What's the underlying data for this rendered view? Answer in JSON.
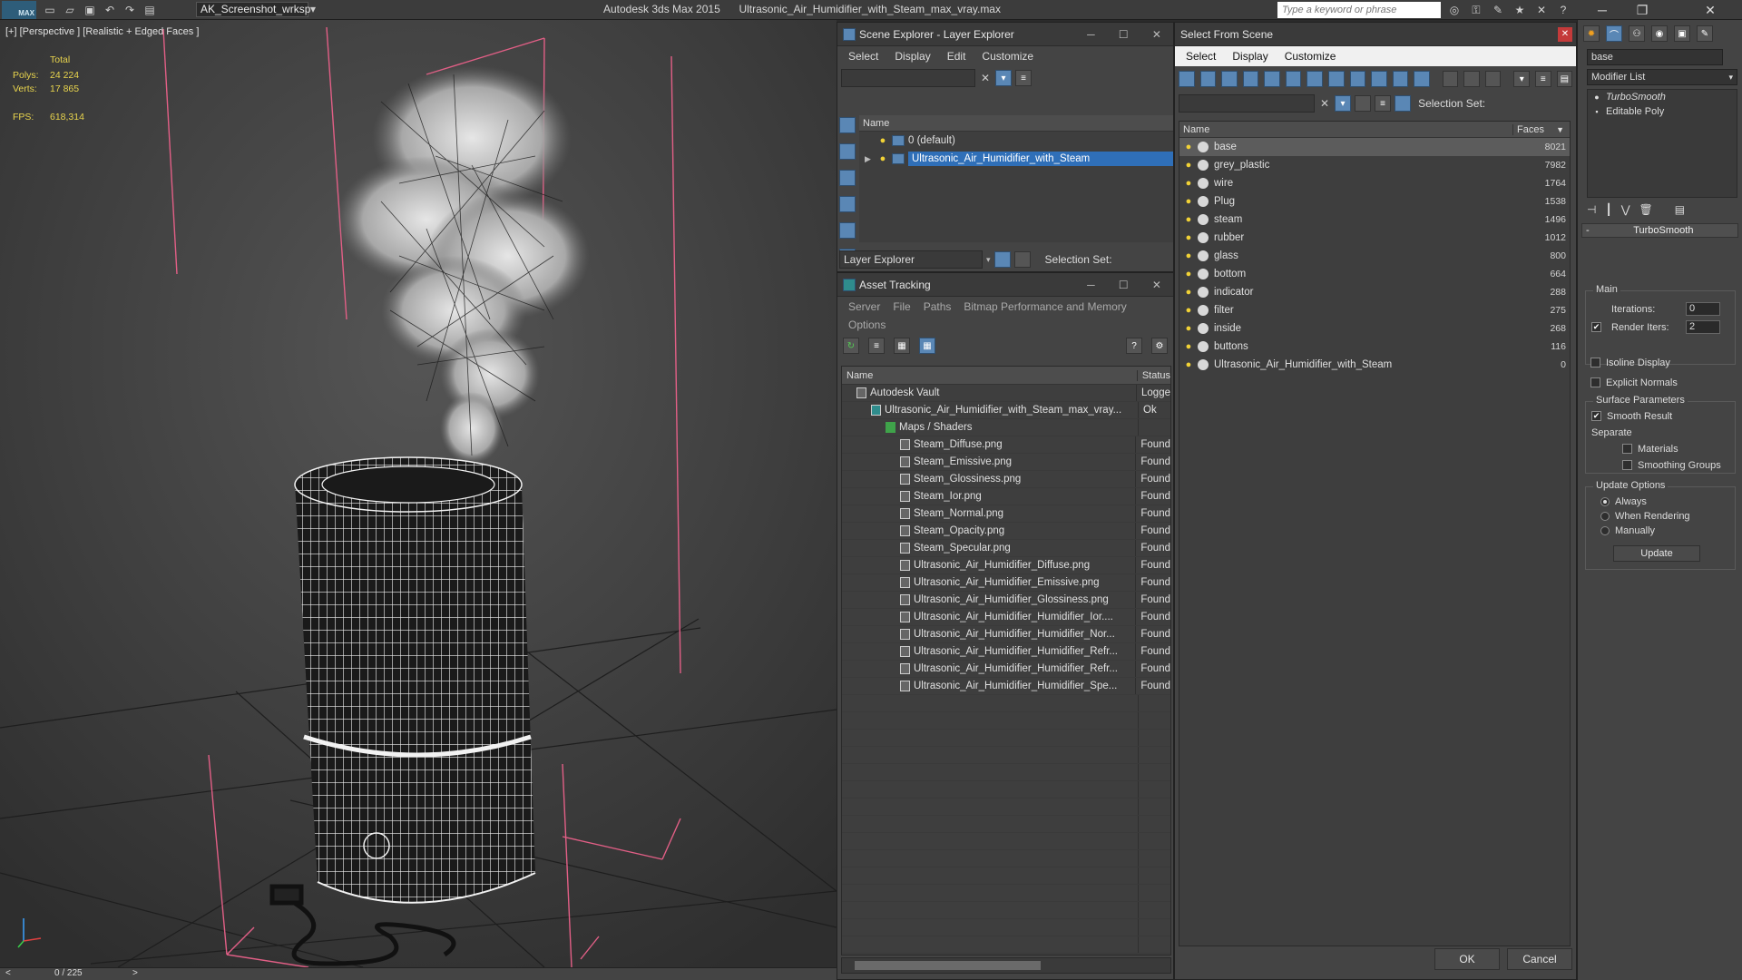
{
  "titlebar": {
    "logo": "MAX",
    "workspace": "AK_Screenshot_wrksp",
    "app_name": "Autodesk 3ds Max  2015",
    "file_name": "Ultrasonic_Air_Humidifier_with_Steam_max_vray.max",
    "search_placeholder": "Type a keyword or phrase"
  },
  "viewport": {
    "label": "[+] [Perspective ] [Realistic + Edged Faces ]",
    "stats": {
      "total_label": "Total",
      "polys_label": "Polys:",
      "polys_value": "24 224",
      "verts_label": "Verts:",
      "verts_value": "17 865",
      "fps_label": "FPS:",
      "fps_value": "618,314"
    },
    "timeline": "0 / 225",
    "timeline_prev": "<",
    "timeline_next": ">"
  },
  "scene_explorer": {
    "title": "Scene Explorer - Layer Explorer",
    "menu": [
      "Select",
      "Display",
      "Edit",
      "Customize"
    ],
    "column": "Name",
    "layers": [
      {
        "name": "0 (default)",
        "selected": false
      },
      {
        "name": "Ultrasonic_Air_Humidifier_with_Steam",
        "selected": true
      }
    ],
    "footer_dropdown": "Layer Explorer",
    "selection_set_label": "Selection Set:"
  },
  "asset_tracking": {
    "title": "Asset Tracking",
    "menu": [
      "Server",
      "File",
      "Paths",
      "Bitmap Performance and Memory"
    ],
    "menu2": "Options",
    "columns": [
      "Name",
      "Status"
    ],
    "rows": [
      {
        "name": "Autodesk Vault",
        "status": "Logge",
        "indent": 1
      },
      {
        "name": "Ultrasonic_Air_Humidifier_with_Steam_max_vray...",
        "status": "Ok",
        "indent": 2
      },
      {
        "name": "Maps / Shaders",
        "status": "",
        "indent": 3
      },
      {
        "name": "Steam_Diffuse.png",
        "status": "Found",
        "indent": 4
      },
      {
        "name": "Steam_Emissive.png",
        "status": "Found",
        "indent": 4
      },
      {
        "name": "Steam_Glossiness.png",
        "status": "Found",
        "indent": 4
      },
      {
        "name": "Steam_Ior.png",
        "status": "Found",
        "indent": 4
      },
      {
        "name": "Steam_Normal.png",
        "status": "Found",
        "indent": 4
      },
      {
        "name": "Steam_Opacity.png",
        "status": "Found",
        "indent": 4
      },
      {
        "name": "Steam_Specular.png",
        "status": "Found",
        "indent": 4
      },
      {
        "name": "Ultrasonic_Air_Humidifier_Diffuse.png",
        "status": "Found",
        "indent": 4
      },
      {
        "name": "Ultrasonic_Air_Humidifier_Emissive.png",
        "status": "Found",
        "indent": 4
      },
      {
        "name": "Ultrasonic_Air_Humidifier_Glossiness.png",
        "status": "Found",
        "indent": 4
      },
      {
        "name": "Ultrasonic_Air_Humidifier_Humidifier_Ior....",
        "status": "Found",
        "indent": 4
      },
      {
        "name": "Ultrasonic_Air_Humidifier_Humidifier_Nor...",
        "status": "Found",
        "indent": 4
      },
      {
        "name": "Ultrasonic_Air_Humidifier_Humidifier_Refr...",
        "status": "Found",
        "indent": 4
      },
      {
        "name": "Ultrasonic_Air_Humidifier_Humidifier_Refr...",
        "status": "Found",
        "indent": 4
      },
      {
        "name": "Ultrasonic_Air_Humidifier_Humidifier_Spe...",
        "status": "Found",
        "indent": 4
      }
    ]
  },
  "select_from_scene": {
    "title": "Select From Scene",
    "menu": [
      "Select",
      "Display",
      "Customize"
    ],
    "selection_set_label": "Selection Set:",
    "columns": [
      "Name",
      "Faces"
    ],
    "objects": [
      {
        "name": "base",
        "faces": "8021",
        "selected": true
      },
      {
        "name": "grey_plastic",
        "faces": "7982",
        "selected": false
      },
      {
        "name": "wire",
        "faces": "1764",
        "selected": false
      },
      {
        "name": "Plug",
        "faces": "1538",
        "selected": false
      },
      {
        "name": "steam",
        "faces": "1496",
        "selected": false
      },
      {
        "name": "rubber",
        "faces": "1012",
        "selected": false
      },
      {
        "name": "glass",
        "faces": "800",
        "selected": false
      },
      {
        "name": "bottom",
        "faces": "664",
        "selected": false
      },
      {
        "name": "indicator",
        "faces": "288",
        "selected": false
      },
      {
        "name": "filter",
        "faces": "275",
        "selected": false
      },
      {
        "name": "inside",
        "faces": "268",
        "selected": false
      },
      {
        "name": "buttons",
        "faces": "116",
        "selected": false
      },
      {
        "name": "Ultrasonic_Air_Humidifier_with_Steam",
        "faces": "0",
        "selected": false
      }
    ],
    "ok_label": "OK",
    "cancel_label": "Cancel"
  },
  "command_panel": {
    "object_name": "base",
    "modifier_list": "Modifier List",
    "stack": [
      "TurboSmooth",
      "Editable Poly"
    ],
    "rollout_title": "TurboSmooth",
    "main_group": "Main",
    "iterations_label": "Iterations:",
    "iterations_value": "0",
    "render_iters_label": "Render Iters:",
    "render_iters_value": "2",
    "render_iters_checked": true,
    "isoline_label": "Isoline Display",
    "explicit_normals_label": "Explicit Normals",
    "surface_group": "Surface Parameters",
    "smooth_result_label": "Smooth Result",
    "separate_label": "Separate",
    "materials_label": "Materials",
    "smoothing_groups_label": "Smoothing Groups",
    "update_group": "Update Options",
    "update_always": "Always",
    "update_rendering": "When Rendering",
    "update_manually": "Manually",
    "update_button": "Update"
  }
}
